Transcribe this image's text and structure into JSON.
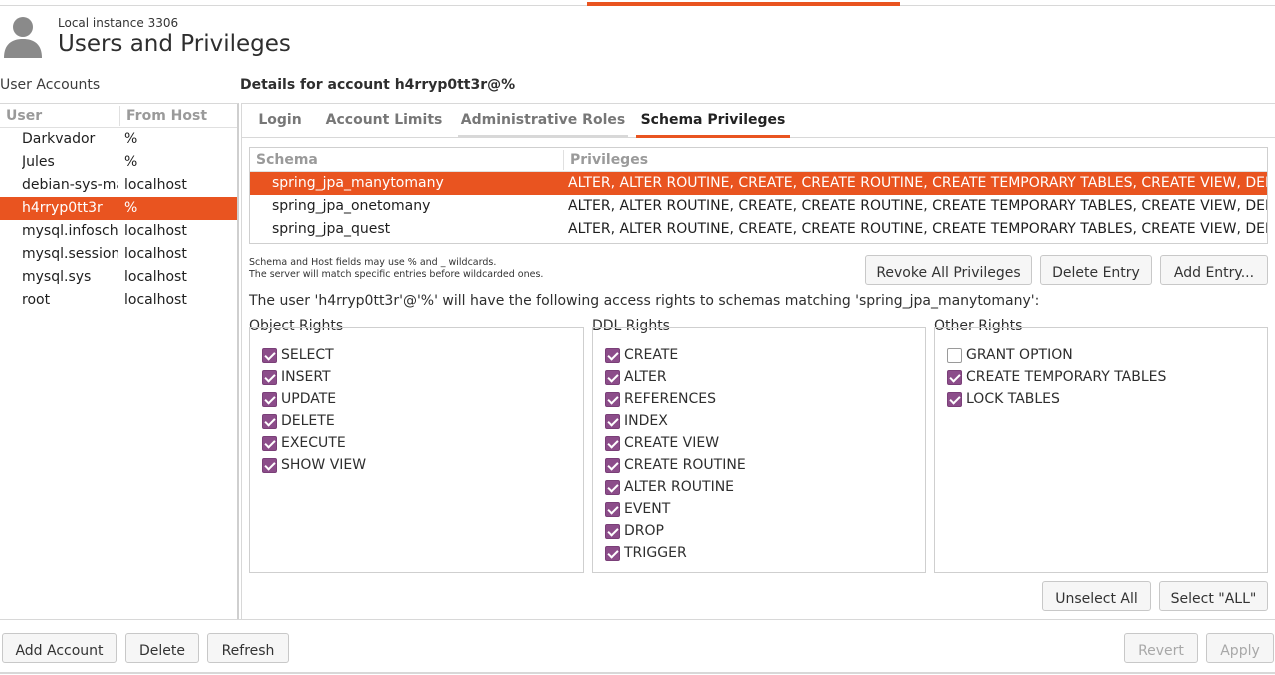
{
  "header": {
    "subtitle": "Local instance 3306",
    "title": "Users and Privileges"
  },
  "user_accounts": {
    "title": "User Accounts",
    "columns": [
      "User",
      "From Host"
    ],
    "rows": [
      {
        "user": "Darkvador",
        "host": "%"
      },
      {
        "user": "Jules",
        "host": "%"
      },
      {
        "user": "debian-sys-maint",
        "host": "localhost"
      },
      {
        "user": "h4rryp0tt3r",
        "host": "%"
      },
      {
        "user": "mysql.infoschema",
        "host": "localhost"
      },
      {
        "user": "mysql.session",
        "host": "localhost"
      },
      {
        "user": "mysql.sys",
        "host": "localhost"
      },
      {
        "user": "root",
        "host": "localhost"
      }
    ],
    "selected_index": 3
  },
  "details": {
    "title": "Details for account h4rryp0tt3r@%",
    "tabs": [
      "Login",
      "Account Limits",
      "Administrative Roles",
      "Schema Privileges"
    ],
    "active_tab": "Schema Privileges"
  },
  "schema_table": {
    "columns": [
      "Schema",
      "Privileges"
    ],
    "rows": [
      {
        "schema": "spring_jpa_manytomany",
        "privileges": "ALTER, ALTER ROUTINE, CREATE, CREATE ROUTINE, CREATE TEMPORARY TABLES, CREATE VIEW, DELETE, DROP, EVENT, EXECUTE, INDEX, INSERT, LOCK TABLES, REFERENCES, SELECT, SHOW VIEW, TRIGGER, UPDATE"
      },
      {
        "schema": "spring_jpa_onetomany",
        "privileges": "ALTER, ALTER ROUTINE, CREATE, CREATE ROUTINE, CREATE TEMPORARY TABLES, CREATE VIEW, DELETE, DROP, EVENT, EXECUTE, INDEX, INSERT, LOCK TABLES, REFERENCES, SELECT, SHOW VIEW, TRIGGER, UPDATE"
      },
      {
        "schema": "spring_jpa_quest",
        "privileges": "ALTER, ALTER ROUTINE, CREATE, CREATE ROUTINE, CREATE TEMPORARY TABLES, CREATE VIEW, DELETE, DROP, EVENT, EXECUTE, INDEX, INSERT, LOCK TABLES, REFERENCES, SELECT, SHOW VIEW, TRIGGER, UPDATE"
      }
    ],
    "selected_index": 0
  },
  "note": {
    "line1": "Schema and Host fields may use % and _ wildcards.",
    "line2": "The server will match specific entries before wildcarded ones."
  },
  "entry_buttons": {
    "revoke_all": "Revoke All Privileges",
    "delete_entry": "Delete Entry",
    "add_entry": "Add Entry..."
  },
  "access_text": "The user 'h4rryp0tt3r'@'%' will have the following access rights to schemas matching 'spring_jpa_manytomany':",
  "object_rights": {
    "title": "Object Rights",
    "items": [
      {
        "label": "SELECT",
        "checked": true
      },
      {
        "label": "INSERT",
        "checked": true
      },
      {
        "label": "UPDATE",
        "checked": true
      },
      {
        "label": "DELETE",
        "checked": true
      },
      {
        "label": "EXECUTE",
        "checked": true
      },
      {
        "label": "SHOW VIEW",
        "checked": true
      }
    ]
  },
  "ddl_rights": {
    "title": "DDL Rights",
    "items": [
      {
        "label": "CREATE",
        "checked": true
      },
      {
        "label": "ALTER",
        "checked": true
      },
      {
        "label": "REFERENCES",
        "checked": true
      },
      {
        "label": "INDEX",
        "checked": true
      },
      {
        "label": "CREATE VIEW",
        "checked": true
      },
      {
        "label": "CREATE ROUTINE",
        "checked": true
      },
      {
        "label": "ALTER ROUTINE",
        "checked": true
      },
      {
        "label": "EVENT",
        "checked": true
      },
      {
        "label": "DROP",
        "checked": true
      },
      {
        "label": "TRIGGER",
        "checked": true
      }
    ]
  },
  "other_rights": {
    "title": "Other Rights",
    "items": [
      {
        "label": "GRANT OPTION",
        "checked": false
      },
      {
        "label": "CREATE TEMPORARY TABLES",
        "checked": true
      },
      {
        "label": "LOCK TABLES",
        "checked": true
      }
    ]
  },
  "select_buttons": {
    "unselect_all": "Unselect All",
    "select_all": "Select \"ALL\""
  },
  "bottom_buttons": {
    "add_account": "Add Account",
    "delete": "Delete",
    "refresh": "Refresh",
    "revert": "Revert",
    "apply": "Apply"
  },
  "colors": {
    "accent": "#e95420",
    "checkbox": "#8c4d8a"
  }
}
